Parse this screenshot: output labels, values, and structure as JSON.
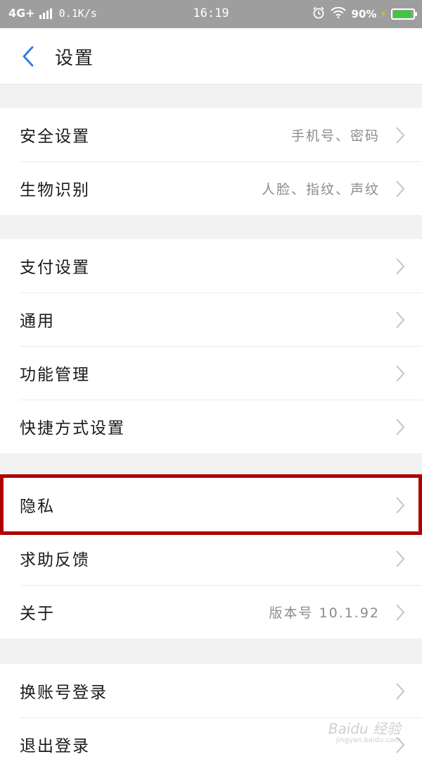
{
  "status_bar": {
    "network": "4G+",
    "speed": "0.1K/s",
    "time": "16:19",
    "battery": "90%",
    "battery_color": "#3ec83e"
  },
  "header": {
    "title": "设置",
    "back_icon": "chevron-left-icon",
    "accent_color": "#2d7be0"
  },
  "groups": [
    {
      "rows": [
        {
          "label": "安全设置",
          "value": "手机号、密码"
        },
        {
          "label": "生物识别",
          "value": "人脸、指纹、声纹"
        }
      ]
    },
    {
      "rows": [
        {
          "label": "支付设置",
          "value": ""
        },
        {
          "label": "通用",
          "value": ""
        },
        {
          "label": "功能管理",
          "value": ""
        },
        {
          "label": "快捷方式设置",
          "value": ""
        }
      ]
    },
    {
      "rows": [
        {
          "label": "隐私",
          "value": ""
        },
        {
          "label": "求助反馈",
          "value": ""
        },
        {
          "label": "关于",
          "value": "版本号 10.1.92"
        }
      ]
    },
    {
      "rows": [
        {
          "label": "换账号登录",
          "value": ""
        },
        {
          "label": "退出登录",
          "value": ""
        }
      ]
    }
  ],
  "highlight_color": "#b00000",
  "watermark": {
    "text": "Baidu 经验",
    "sub": "jingyan.baidu.com"
  }
}
